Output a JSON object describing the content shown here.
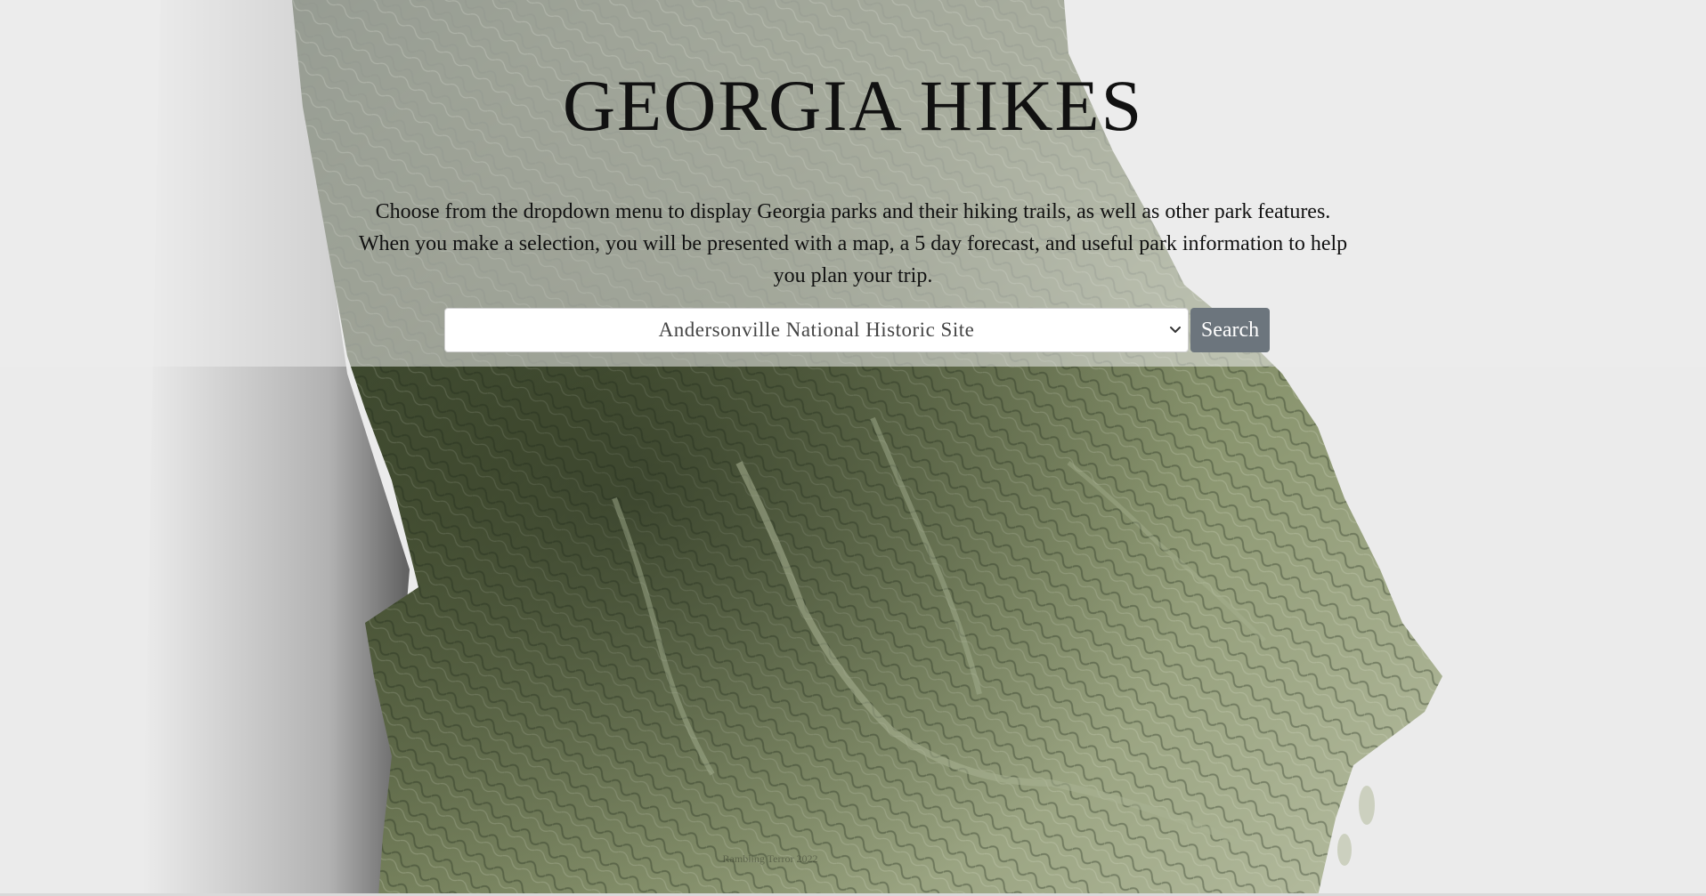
{
  "page": {
    "title": "GEORGIA HIKES",
    "intro": "Choose from the dropdown menu to display Georgia parks and their hiking trails, as well as other park features. When you make a selection, you will be presented with a map, a 5 day forecast, and useful park information to help you plan your trip."
  },
  "search": {
    "selected_park": "Andersonville National Historic Site",
    "button_label": "Search"
  },
  "footer": {
    "credit": "Rambling Terror 2022"
  },
  "colors": {
    "background": "#ebebeb",
    "terrain_dark": "#2f3a26",
    "terrain_mid": "#7d8a66",
    "terrain_light": "#b7bea3",
    "button": "#6c757d"
  }
}
